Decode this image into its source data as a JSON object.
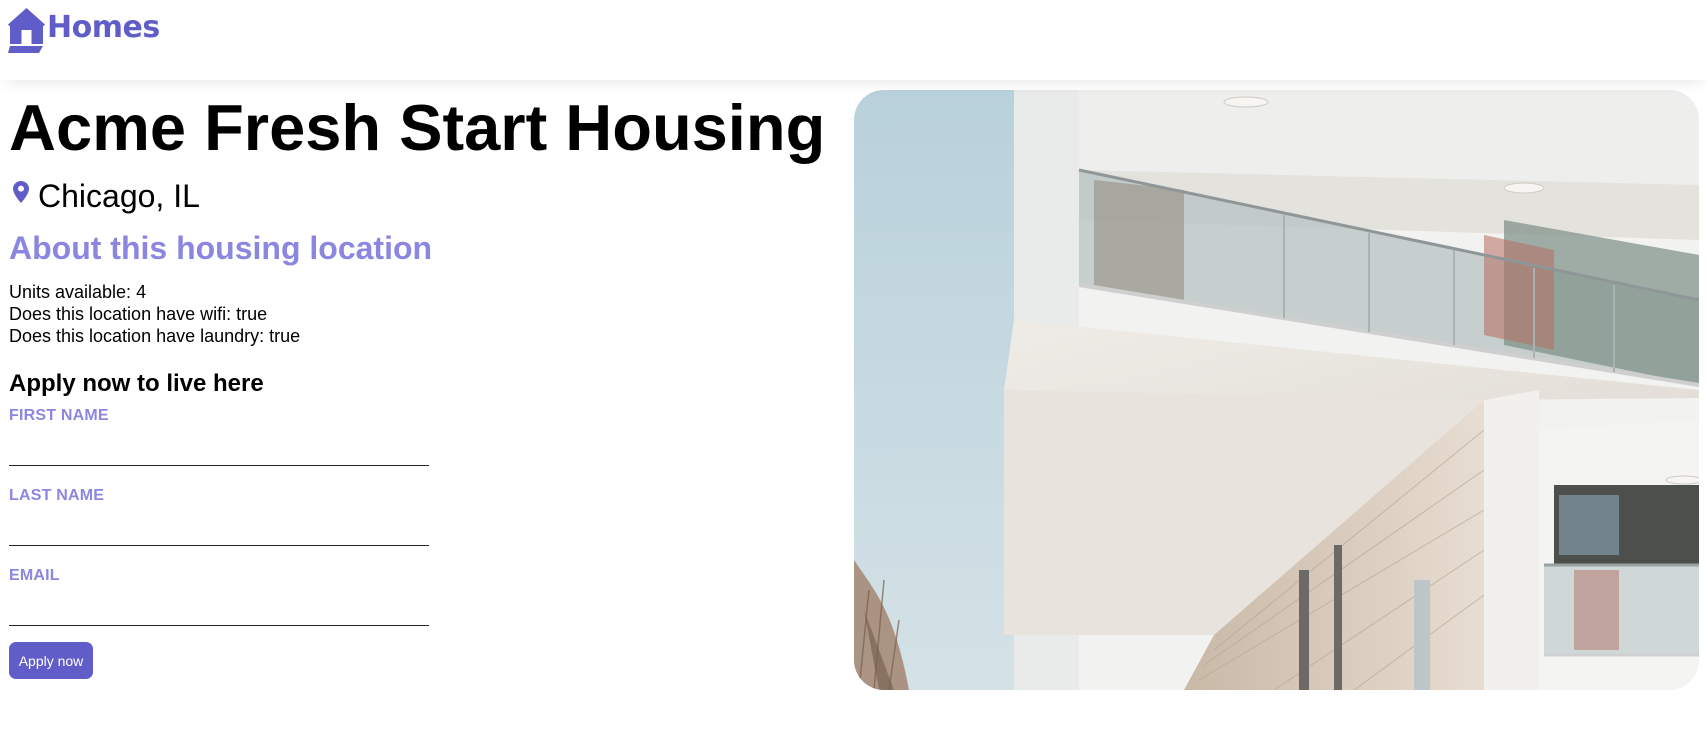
{
  "header": {
    "brand_name": "Homes",
    "logo_icon": "house-icon",
    "brand_color": "#605dc8"
  },
  "listing": {
    "name": "Acme Fresh Start Housing",
    "location_icon": "map-pin-icon",
    "location": "Chicago, IL",
    "photo_description": "modern white apartment building with glass balconies"
  },
  "about": {
    "heading": "About this housing location",
    "heading_color": "#8b87e0",
    "features": [
      "Units available: 4",
      "Does this location have wifi: true",
      "Does this location have laundry: true"
    ]
  },
  "apply": {
    "heading": "Apply now to live here",
    "fields": [
      {
        "label": "FIRST NAME",
        "value": ""
      },
      {
        "label": "LAST NAME",
        "value": ""
      },
      {
        "label": "EMAIL",
        "value": ""
      }
    ],
    "button_label": "Apply now"
  }
}
